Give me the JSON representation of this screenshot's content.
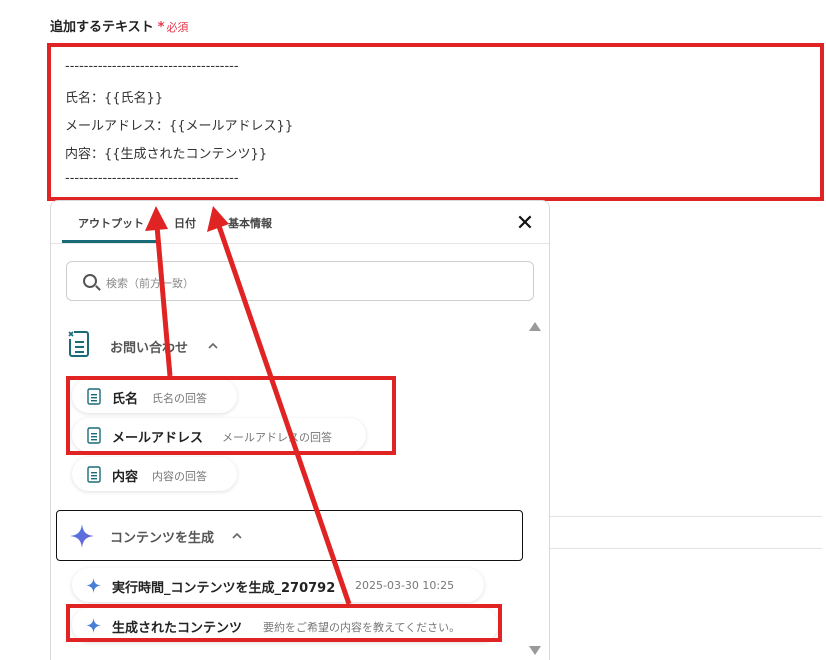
{
  "field": {
    "label": "追加するテキスト",
    "required_mark": "*",
    "required_text": "必須",
    "lines": [
      "-------------------------------------",
      "氏名：{{氏名}}",
      "メールアドレス：{{メールアドレス}}",
      "内容：{{生成されたコンテンツ}}",
      "-------------------------------------"
    ]
  },
  "panel": {
    "tabs": [
      "アウトプット",
      "日付",
      "基本情報"
    ],
    "active_tab": "アウトプット",
    "close_label": "✕",
    "search_placeholder": "検索（前方一致）",
    "groups": [
      {
        "title": "お問い合わせ",
        "icon": "form-doc-icon",
        "items": [
          {
            "name": "氏名",
            "desc": "氏名の回答"
          },
          {
            "name": "メールアドレス",
            "desc": "メールアドレスの回答"
          },
          {
            "name": "内容",
            "desc": "内容の回答"
          }
        ]
      },
      {
        "title": "コンテンツを生成",
        "icon": "ai-sparkle-icon",
        "items": [
          {
            "name": "実行時間_コンテンツを生成_270792",
            "desc": "2025-03-30 10:25"
          },
          {
            "name": "生成されたコンテンツ",
            "desc": "要約をご希望の内容を教えてください。"
          }
        ]
      }
    ]
  },
  "colors": {
    "annotation_red": "#e02424",
    "tab_accent": "#1a6b78",
    "required": "#e5384b",
    "sparkle_blue": "#4a7fd6"
  }
}
